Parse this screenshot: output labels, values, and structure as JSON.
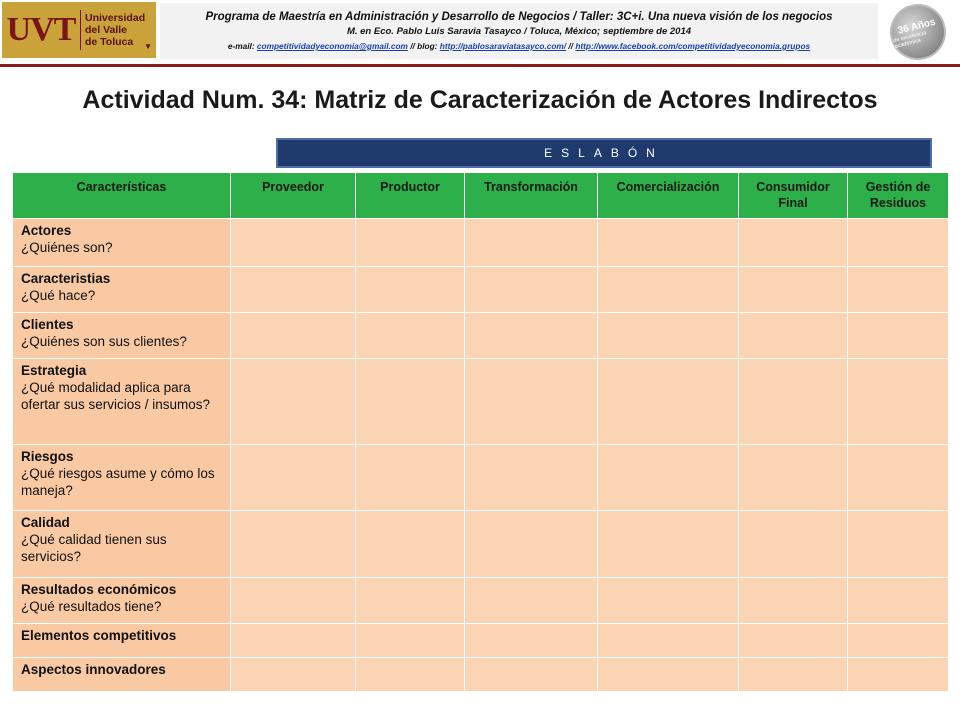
{
  "header": {
    "logo": {
      "mark": "UVT",
      "name_lines": [
        "Universidad",
        "del Valle",
        "de Toluca"
      ]
    },
    "line1": "Programa de Maestría en Administración y Desarrollo de Negocios / Taller: 3C+i. Una nueva visión de los negocios",
    "line2": "M. en Eco. Pablo Luis Saravia Tasayco / Toluca, México; septiembre de 2014",
    "line3": {
      "email_label": "e-mail: ",
      "email": "competitividadyeconomia@gmail.com",
      "blog_label": " // blog: ",
      "blog": "http://pablosaraviatasayco.com/",
      "sep": " // ",
      "facebook": "http://www.facebook.com/competitividadyeconomia.grupos"
    },
    "badge": {
      "main": "36 Años",
      "sub": "de excelencia académica"
    }
  },
  "title": "Actividad Num. 34: Matriz de Caracterización de Actores Indirectos",
  "banner": "ESLABÓN",
  "table": {
    "columns": [
      "Características",
      "Proveedor",
      "Productor",
      "Transformación",
      "Comercialización",
      "Consumidor Final",
      "Gestión de Residuos"
    ],
    "rows": [
      {
        "title": "Actores",
        "desc": "¿Quiénes son?"
      },
      {
        "title": "Caracteristias",
        "desc": "¿Qué hace?"
      },
      {
        "title": "Clientes",
        "desc": "¿Quiénes son sus clientes?"
      },
      {
        "title": "Estrategia",
        "desc": "¿Qué modalidad aplica para ofertar sus servicios / insumos?"
      },
      {
        "title": "Riesgos",
        "desc": "¿Qué riesgos asume y cómo los maneja?"
      },
      {
        "title": "Calidad",
        "desc": "¿Qué calidad tienen sus servicios?"
      },
      {
        "title": "Resultados económicos",
        "desc": "¿Qué resultados tiene?"
      },
      {
        "title": "Elementos competitivos",
        "desc": ""
      },
      {
        "title": "Aspectos innovadores",
        "desc": ""
      }
    ]
  },
  "colors": {
    "header_green": "#2db04a",
    "row_peach": "#fbd4b4",
    "banner_navy": "#1f3b6e",
    "rule_maroon": "#8b1a1a",
    "logo_gold": "#caa23a"
  }
}
